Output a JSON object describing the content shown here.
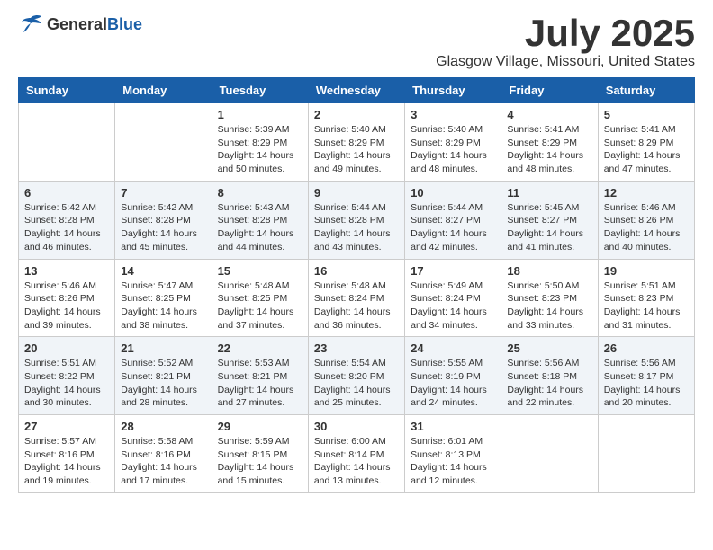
{
  "logo": {
    "general": "General",
    "blue": "Blue"
  },
  "title": "July 2025",
  "location": "Glasgow Village, Missouri, United States",
  "weekdays": [
    "Sunday",
    "Monday",
    "Tuesday",
    "Wednesday",
    "Thursday",
    "Friday",
    "Saturday"
  ],
  "weeks": [
    [
      {
        "day": "",
        "info": ""
      },
      {
        "day": "",
        "info": ""
      },
      {
        "day": "1",
        "info": "Sunrise: 5:39 AM\nSunset: 8:29 PM\nDaylight: 14 hours and 50 minutes."
      },
      {
        "day": "2",
        "info": "Sunrise: 5:40 AM\nSunset: 8:29 PM\nDaylight: 14 hours and 49 minutes."
      },
      {
        "day": "3",
        "info": "Sunrise: 5:40 AM\nSunset: 8:29 PM\nDaylight: 14 hours and 48 minutes."
      },
      {
        "day": "4",
        "info": "Sunrise: 5:41 AM\nSunset: 8:29 PM\nDaylight: 14 hours and 48 minutes."
      },
      {
        "day": "5",
        "info": "Sunrise: 5:41 AM\nSunset: 8:29 PM\nDaylight: 14 hours and 47 minutes."
      }
    ],
    [
      {
        "day": "6",
        "info": "Sunrise: 5:42 AM\nSunset: 8:28 PM\nDaylight: 14 hours and 46 minutes."
      },
      {
        "day": "7",
        "info": "Sunrise: 5:42 AM\nSunset: 8:28 PM\nDaylight: 14 hours and 45 minutes."
      },
      {
        "day": "8",
        "info": "Sunrise: 5:43 AM\nSunset: 8:28 PM\nDaylight: 14 hours and 44 minutes."
      },
      {
        "day": "9",
        "info": "Sunrise: 5:44 AM\nSunset: 8:28 PM\nDaylight: 14 hours and 43 minutes."
      },
      {
        "day": "10",
        "info": "Sunrise: 5:44 AM\nSunset: 8:27 PM\nDaylight: 14 hours and 42 minutes."
      },
      {
        "day": "11",
        "info": "Sunrise: 5:45 AM\nSunset: 8:27 PM\nDaylight: 14 hours and 41 minutes."
      },
      {
        "day": "12",
        "info": "Sunrise: 5:46 AM\nSunset: 8:26 PM\nDaylight: 14 hours and 40 minutes."
      }
    ],
    [
      {
        "day": "13",
        "info": "Sunrise: 5:46 AM\nSunset: 8:26 PM\nDaylight: 14 hours and 39 minutes."
      },
      {
        "day": "14",
        "info": "Sunrise: 5:47 AM\nSunset: 8:25 PM\nDaylight: 14 hours and 38 minutes."
      },
      {
        "day": "15",
        "info": "Sunrise: 5:48 AM\nSunset: 8:25 PM\nDaylight: 14 hours and 37 minutes."
      },
      {
        "day": "16",
        "info": "Sunrise: 5:48 AM\nSunset: 8:24 PM\nDaylight: 14 hours and 36 minutes."
      },
      {
        "day": "17",
        "info": "Sunrise: 5:49 AM\nSunset: 8:24 PM\nDaylight: 14 hours and 34 minutes."
      },
      {
        "day": "18",
        "info": "Sunrise: 5:50 AM\nSunset: 8:23 PM\nDaylight: 14 hours and 33 minutes."
      },
      {
        "day": "19",
        "info": "Sunrise: 5:51 AM\nSunset: 8:23 PM\nDaylight: 14 hours and 31 minutes."
      }
    ],
    [
      {
        "day": "20",
        "info": "Sunrise: 5:51 AM\nSunset: 8:22 PM\nDaylight: 14 hours and 30 minutes."
      },
      {
        "day": "21",
        "info": "Sunrise: 5:52 AM\nSunset: 8:21 PM\nDaylight: 14 hours and 28 minutes."
      },
      {
        "day": "22",
        "info": "Sunrise: 5:53 AM\nSunset: 8:21 PM\nDaylight: 14 hours and 27 minutes."
      },
      {
        "day": "23",
        "info": "Sunrise: 5:54 AM\nSunset: 8:20 PM\nDaylight: 14 hours and 25 minutes."
      },
      {
        "day": "24",
        "info": "Sunrise: 5:55 AM\nSunset: 8:19 PM\nDaylight: 14 hours and 24 minutes."
      },
      {
        "day": "25",
        "info": "Sunrise: 5:56 AM\nSunset: 8:18 PM\nDaylight: 14 hours and 22 minutes."
      },
      {
        "day": "26",
        "info": "Sunrise: 5:56 AM\nSunset: 8:17 PM\nDaylight: 14 hours and 20 minutes."
      }
    ],
    [
      {
        "day": "27",
        "info": "Sunrise: 5:57 AM\nSunset: 8:16 PM\nDaylight: 14 hours and 19 minutes."
      },
      {
        "day": "28",
        "info": "Sunrise: 5:58 AM\nSunset: 8:16 PM\nDaylight: 14 hours and 17 minutes."
      },
      {
        "day": "29",
        "info": "Sunrise: 5:59 AM\nSunset: 8:15 PM\nDaylight: 14 hours and 15 minutes."
      },
      {
        "day": "30",
        "info": "Sunrise: 6:00 AM\nSunset: 8:14 PM\nDaylight: 14 hours and 13 minutes."
      },
      {
        "day": "31",
        "info": "Sunrise: 6:01 AM\nSunset: 8:13 PM\nDaylight: 14 hours and 12 minutes."
      },
      {
        "day": "",
        "info": ""
      },
      {
        "day": "",
        "info": ""
      }
    ]
  ]
}
